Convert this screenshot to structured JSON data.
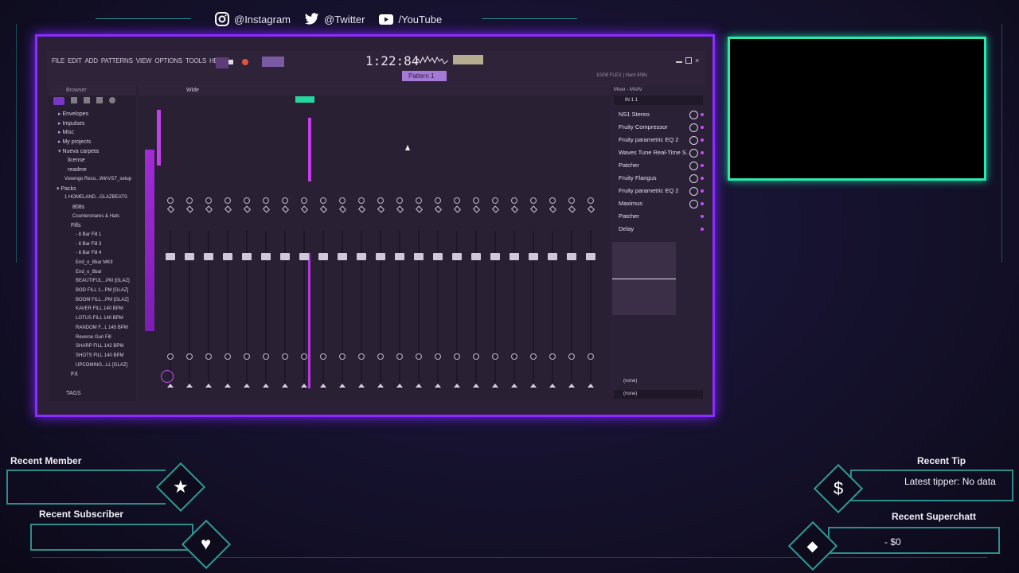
{
  "socials": {
    "instagram": "@Instagram",
    "twitter": "@Twitter",
    "youtube": "/YouTube"
  },
  "fl": {
    "menu": [
      "FILE",
      "EDIT",
      "ADD",
      "PATTERNS",
      "VIEW",
      "OPTIONS",
      "TOOLS",
      "HELP"
    ],
    "time": "1:22:84",
    "pattern": "Pattern 1",
    "hint": "10/08 FLEX | Hard 808s",
    "browser_title": "Browser",
    "browser_items": [
      "Envelopes",
      "Impulses",
      "Misc",
      "My projects",
      "Nueva carpeta",
      "license",
      "readme",
      "Voxengo Reco...WinVST_setup",
      "Packs",
      "1 HOMELAND...GLAZBEATS",
      "808s",
      "Countersnares & Hats",
      "Fills",
      "- 8 Bar Fill 1",
      "- 8 Bar Fill 3",
      "- 8 Bar Fill 4",
      "End_o_8bar MKII",
      "End_o_8bar",
      "BEAUTIFUL...PM [GLAZ]",
      "BOD FILL 1...PM [GLAZ]",
      "BOOM FILL...PM [GLAZ]",
      "KAVER FILL 140 BPM",
      "LOTUS FILL 140 BPM",
      "RANDOM F...L 145 BPM",
      "Reverse Gun Fill",
      "SHARP FILL 142 BPM",
      "SHOTS FILL 140 BPM",
      "UPCOMING...LL [GLAZ]",
      "FX"
    ],
    "tags": "TAGS",
    "mixer_view": "Wide",
    "mixer_title": "Mixer - MAIN",
    "input": "IN 1 1",
    "inserts": [
      "NS1 Stereo",
      "Fruity Compressor",
      "Fruity parametric EQ 2",
      "Waves Tune Real-Time S...",
      "Patcher",
      "Fruity Flangus",
      "Fruity parametric EQ 2",
      "Maximus",
      "Patcher",
      "Delay"
    ],
    "none1": "(none)",
    "none2": "(none)"
  },
  "widgets": {
    "recent_member": "Recent Member",
    "recent_subscriber": "Recent Subscriber",
    "recent_tip": "Recent Tip",
    "latest_tipper": "Latest tipper: No data",
    "recent_superchat": "Recent Superchatt",
    "superchat_value": "- $0"
  },
  "colors": {
    "accent_purple": "#8a2cff",
    "accent_teal": "#29e8b0",
    "frame_teal": "#2b8f8c"
  }
}
